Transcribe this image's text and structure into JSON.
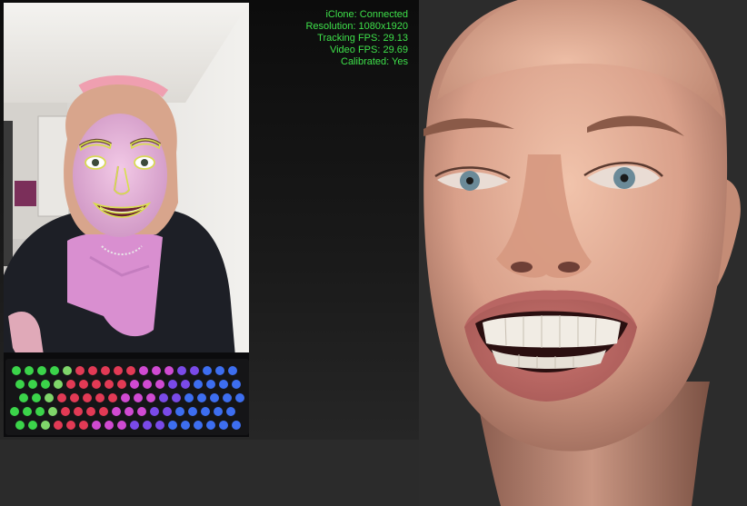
{
  "status": {
    "connection": "iClone: Connected",
    "resolution": "Resolution: 1080x1920",
    "tracking_fps": "Tracking FPS: 29.13",
    "video_fps": "Video FPS: 29.69",
    "calibrated": "Calibrated: Yes"
  },
  "colors": {
    "status_text": "#3ee04a",
    "tracking_mesh": "#d8e04a",
    "panel_bg": "#111111",
    "viewport_bg": "#2c2c2c"
  }
}
